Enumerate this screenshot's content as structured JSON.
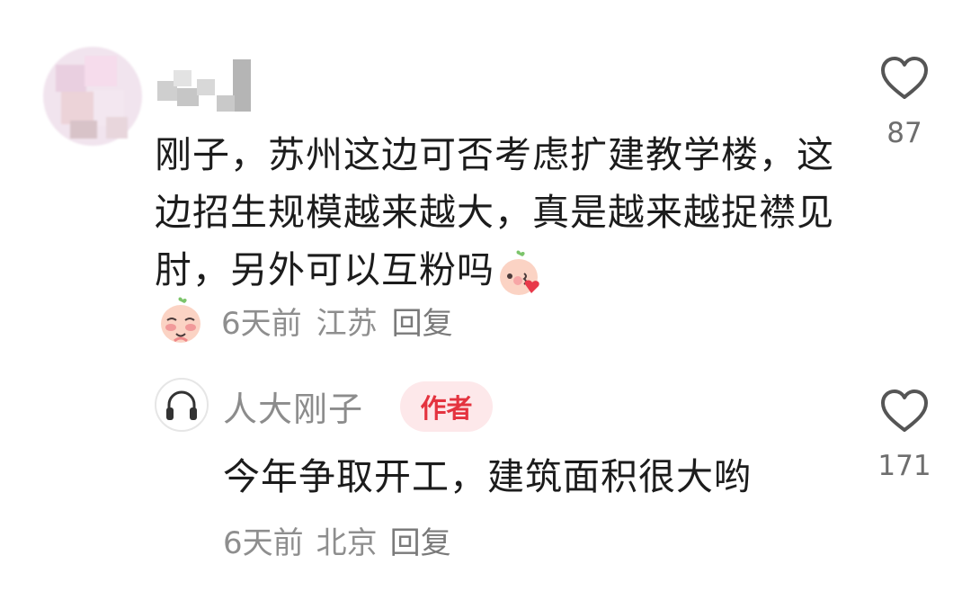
{
  "comment": {
    "text": "刚子，苏州这边可否考虑扩建教学楼，这边招生规模越来越大，真是越来越捉襟见肘，另外可以互粉吗",
    "time": "6天前",
    "location": "江苏",
    "reply_label": "回复",
    "likes": "87"
  },
  "reply": {
    "username": "人大刚子",
    "badge": "作者",
    "text": "今年争取开工，建筑面积很大哟",
    "time": "6天前",
    "location": "北京",
    "reply_label": "回复",
    "likes": "171"
  },
  "colors": {
    "badge_bg": "#fde8ea",
    "badge_text": "#e4333f",
    "meta_text": "#8e8e8e"
  },
  "icons": {
    "like": "heart-outline-icon",
    "reply_avatar": "headphones-icon",
    "emoji_blush": "blushing-peach-emoji",
    "emoji_shy": "shy-peach-emoji"
  }
}
